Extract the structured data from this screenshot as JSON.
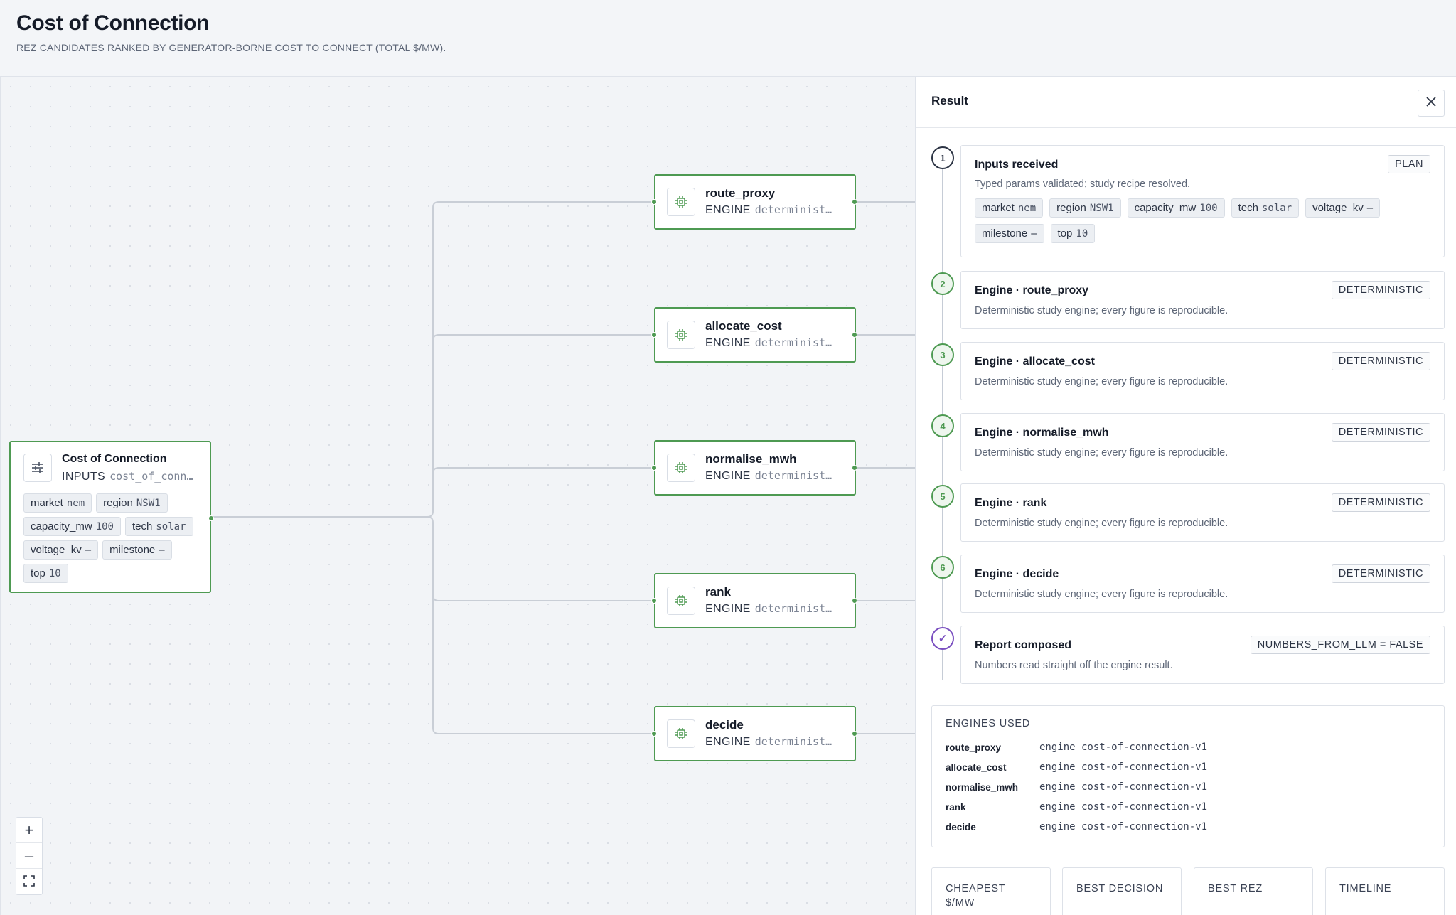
{
  "header": {
    "title": "Cost of Connection",
    "subtitle": "REZ CANDIDATES RANKED BY GENERATOR-BORNE COST TO CONNECT (TOTAL $/MW)."
  },
  "canvas": {
    "input_node": {
      "title": "Cost of Connection",
      "kind": "INPUTS",
      "ref": "cost_of_conn…",
      "icon": "sliders-icon",
      "params": [
        {
          "key": "market",
          "value": "nem"
        },
        {
          "key": "region",
          "value": "NSW1"
        },
        {
          "key": "capacity_mw",
          "value": "100"
        },
        {
          "key": "tech",
          "value": "solar"
        },
        {
          "key": "voltage_kv",
          "value": "–"
        },
        {
          "key": "milestone",
          "value": "–"
        },
        {
          "key": "top",
          "value": "10"
        }
      ]
    },
    "engine_nodes": [
      {
        "title": "route_proxy",
        "kind": "ENGINE",
        "ref": "determinist…",
        "icon": "chip-icon"
      },
      {
        "title": "allocate_cost",
        "kind": "ENGINE",
        "ref": "determinist…",
        "icon": "chip-icon"
      },
      {
        "title": "normalise_mwh",
        "kind": "ENGINE",
        "ref": "determinist…",
        "icon": "chip-icon"
      },
      {
        "title": "rank",
        "kind": "ENGINE",
        "ref": "determinist…",
        "icon": "chip-icon"
      },
      {
        "title": "decide",
        "kind": "ENGINE",
        "ref": "determinist…",
        "icon": "chip-icon"
      }
    ],
    "zoom_controls": {
      "zoom_in": "+",
      "zoom_out": "–",
      "fit_icon": "fit-view-icon"
    }
  },
  "panel": {
    "title": "Result",
    "close_icon": "close-icon",
    "steps": [
      {
        "marker": "1",
        "title": "Inputs received",
        "badge": "PLAN",
        "desc": "Typed params validated; study recipe resolved.",
        "params": [
          {
            "key": "market",
            "value": "nem"
          },
          {
            "key": "region",
            "value": "NSW1"
          },
          {
            "key": "capacity_mw",
            "value": "100"
          },
          {
            "key": "tech",
            "value": "solar"
          },
          {
            "key": "voltage_kv",
            "value": "–"
          },
          {
            "key": "milestone",
            "value": "–"
          },
          {
            "key": "top",
            "value": "10"
          }
        ]
      },
      {
        "marker": "2",
        "title": "Engine · route_proxy",
        "badge": "DETERMINISTIC",
        "desc": "Deterministic study engine; every figure is reproducible."
      },
      {
        "marker": "3",
        "title": "Engine · allocate_cost",
        "badge": "DETERMINISTIC",
        "desc": "Deterministic study engine; every figure is reproducible."
      },
      {
        "marker": "4",
        "title": "Engine · normalise_mwh",
        "badge": "DETERMINISTIC",
        "desc": "Deterministic study engine; every figure is reproducible."
      },
      {
        "marker": "5",
        "title": "Engine · rank",
        "badge": "DETERMINISTIC",
        "desc": "Deterministic study engine; every figure is reproducible."
      },
      {
        "marker": "6",
        "title": "Engine · decide",
        "badge": "DETERMINISTIC",
        "desc": "Deterministic study engine; every figure is reproducible."
      },
      {
        "marker": "✓",
        "title": "Report composed",
        "badge": "NUMBERS_FROM_LLM = FALSE",
        "desc": "Numbers read straight off the engine result."
      }
    ],
    "engines_used": {
      "heading": "ENGINES USED",
      "rows": [
        {
          "name": "route_proxy",
          "value": "engine cost-of-connection-v1"
        },
        {
          "name": "allocate_cost",
          "value": "engine cost-of-connection-v1"
        },
        {
          "name": "normalise_mwh",
          "value": "engine cost-of-connection-v1"
        },
        {
          "name": "rank",
          "value": "engine cost-of-connection-v1"
        },
        {
          "name": "decide",
          "value": "engine cost-of-connection-v1"
        }
      ]
    },
    "stats": [
      {
        "label": "CHEAPEST $/MW"
      },
      {
        "label": "BEST DECISION"
      },
      {
        "label": "BEST REZ"
      },
      {
        "label": "TIMELINE"
      }
    ]
  },
  "colors": {
    "accent_green": "#4e9a52",
    "report_purple": "#7a4fc0",
    "edge_gray": "#c9ced6"
  }
}
